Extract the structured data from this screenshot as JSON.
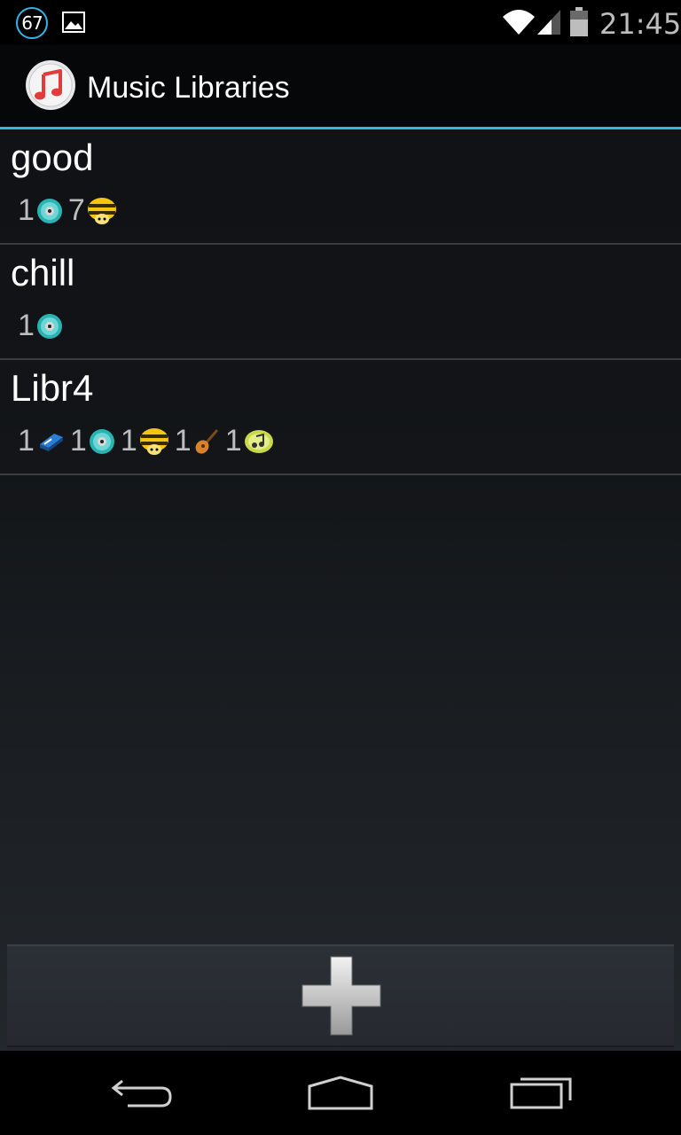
{
  "status_bar": {
    "notification_count": "67",
    "time": "21:45"
  },
  "action_bar": {
    "title": "Music Libraries",
    "app_icon": "music-note-icon"
  },
  "libraries": [
    {
      "name": "good",
      "stats": [
        {
          "count": "1",
          "icon": "cd-icon"
        },
        {
          "count": "7",
          "icon": "bee-icon"
        }
      ]
    },
    {
      "name": "chill",
      "stats": [
        {
          "count": "1",
          "icon": "cd-icon"
        }
      ]
    },
    {
      "name": "Libr4",
      "stats": [
        {
          "count": "1",
          "icon": "blue-piano-icon"
        },
        {
          "count": "1",
          "icon": "cd-icon"
        },
        {
          "count": "1",
          "icon": "bee-icon"
        },
        {
          "count": "1",
          "icon": "guitar-icon"
        },
        {
          "count": "1",
          "icon": "music-disc-icon"
        }
      ]
    }
  ],
  "bottom_bar": {
    "add_icon": "plus-icon"
  },
  "colors": {
    "accent": "#33b5e5",
    "text_secondary": "#bdbdbd"
  }
}
